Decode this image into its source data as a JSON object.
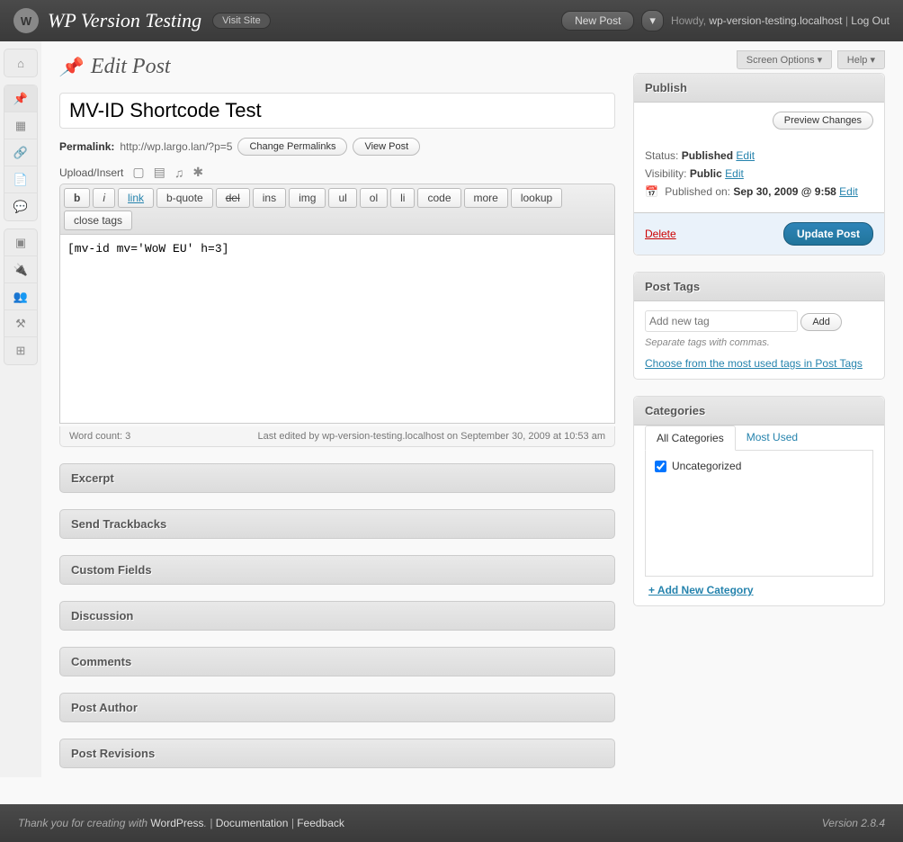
{
  "header": {
    "site_title": "WP Version Testing",
    "visit_site": "Visit Site",
    "new_post": "New Post",
    "howdy": "Howdy,",
    "user": "wp-version-testing.localhost",
    "logout": "Log Out"
  },
  "top_tabs": {
    "screen_options": "Screen Options",
    "help": "Help"
  },
  "page_title": "Edit Post",
  "post": {
    "title": "MV-ID Shortcode Test",
    "permalink_label": "Permalink:",
    "permalink_url": "http://wp.largo.lan/?p=5",
    "change_permalinks": "Change Permalinks",
    "view_post": "View Post",
    "upload_label": "Upload/Insert",
    "content": "[mv-id mv='WoW EU' h=3]",
    "word_count_label": "Word count:",
    "word_count": "3",
    "last_edited": "Last edited by wp-version-testing.localhost on September 30, 2009 at 10:53 am"
  },
  "editor_buttons": {
    "b": "b",
    "i": "i",
    "link": "link",
    "bquote": "b-quote",
    "del": "del",
    "ins": "ins",
    "img": "img",
    "ul": "ul",
    "ol": "ol",
    "li": "li",
    "code": "code",
    "more": "more",
    "lookup": "lookup",
    "close": "close tags"
  },
  "metaboxes": {
    "excerpt": "Excerpt",
    "trackbacks": "Send Trackbacks",
    "custom_fields": "Custom Fields",
    "discussion": "Discussion",
    "comments": "Comments",
    "author": "Post Author",
    "revisions": "Post Revisions"
  },
  "publish": {
    "title": "Publish",
    "preview": "Preview Changes",
    "status_label": "Status:",
    "status": "Published",
    "visibility_label": "Visibility:",
    "visibility": "Public",
    "published_label": "Published on:",
    "published_date": "Sep 30, 2009 @ 9:58",
    "edit": "Edit",
    "delete": "Delete",
    "update": "Update Post"
  },
  "tags": {
    "title": "Post Tags",
    "placeholder": "Add new tag",
    "add": "Add",
    "hint": "Separate tags with commas.",
    "choose": "Choose from the most used tags in Post Tags"
  },
  "categories": {
    "title": "Categories",
    "tab_all": "All Categories",
    "tab_most": "Most Used",
    "items": [
      {
        "label": "Uncategorized",
        "checked": true
      }
    ],
    "add_new": "+ Add New Category"
  },
  "footer": {
    "thanks": "Thank you for creating with",
    "wp": "WordPress",
    "doc": "Documentation",
    "feedback": "Feedback",
    "version": "Version 2.8.4"
  }
}
